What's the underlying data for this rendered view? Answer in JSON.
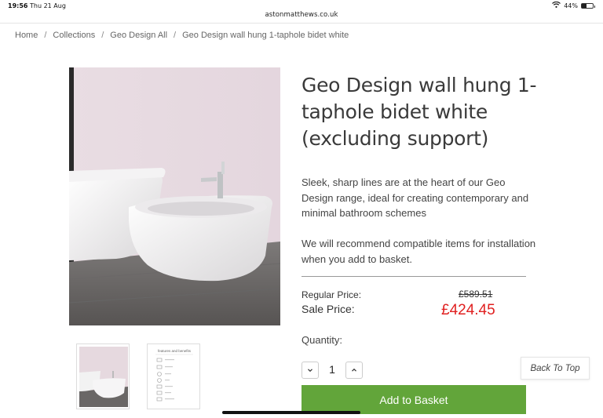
{
  "status_bar": {
    "time": "19:56",
    "date": "Thu 21 Aug",
    "battery": "44%",
    "battery_level": 0.44
  },
  "browser": {
    "url": "astonmatthews.co.uk"
  },
  "breadcrumb": {
    "items": [
      "Home",
      "Collections",
      "Geo Design All",
      "Geo Design wall hung 1-taphole bidet white"
    ],
    "separator": "/"
  },
  "product": {
    "title": "Geo Design wall hung 1-taphole bidet white (excluding support)",
    "description": "Sleek, sharp lines are at the heart of our Geo Design range, ideal for creating contemporary and minimal bathroom schemes",
    "recommendation": "We will recommend compatible items for installation when you add to basket.",
    "regular_price_label": "Regular Price:",
    "regular_price": "£589.51",
    "sale_price_label": "Sale Price:",
    "sale_price": "£424.45",
    "quantity_label": "Quantity:",
    "quantity": "1",
    "add_to_basket": "Add to Basket",
    "thumbnail_doc_title": "features and benefits"
  },
  "back_to_top": "Back To Top",
  "colors": {
    "sale_red": "#e02020",
    "basket_green": "#62a53a"
  },
  "icons": [
    "wifi-icon",
    "battery-icon",
    "chevron-down-icon",
    "chevron-up-icon"
  ]
}
